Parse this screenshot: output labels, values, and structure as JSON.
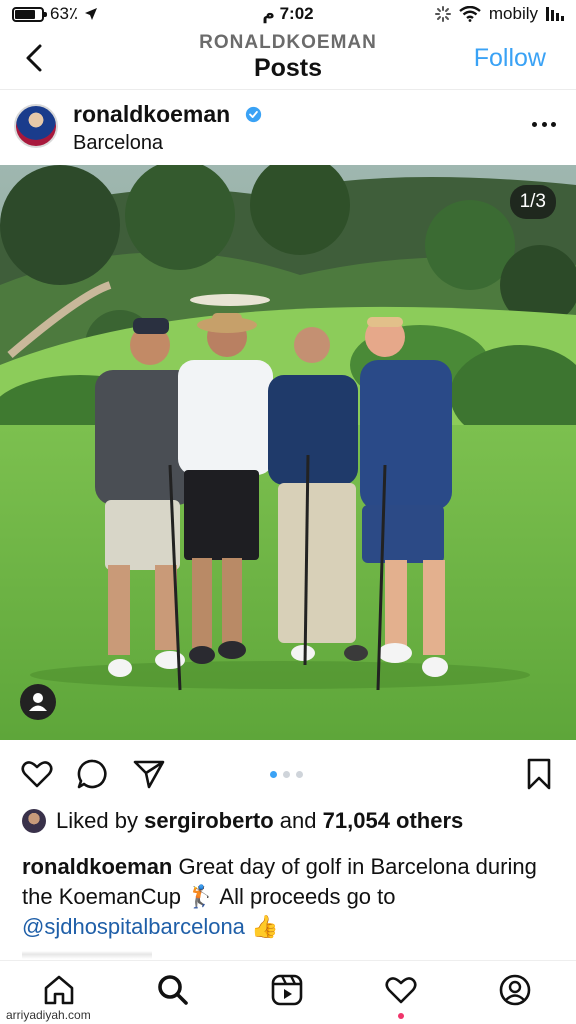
{
  "status_bar": {
    "battery": "63٪",
    "time": "7:02 م",
    "carrier": "mobily"
  },
  "header": {
    "account": "RONALDKOEMAN",
    "title": "Posts",
    "follow_label": "Follow"
  },
  "post": {
    "username": "ronaldkoeman",
    "location": "Barcelona",
    "image_counter": "1/3",
    "carousel_total": 3,
    "carousel_active": 1
  },
  "likes": {
    "prefix": "Liked by",
    "user": "sergiroberto",
    "middle": "and",
    "count": "71,054 others"
  },
  "caption": {
    "username": "ronaldkoeman",
    "text": "Great day of golf in Barcelona during the KoemanCup 🏌️ All proceeds go to",
    "mention": "@sjdhospitalbarcelona",
    "emoji": "👍"
  },
  "icons": {
    "back": "chevron-left-icon",
    "verified": "verified-badge-icon",
    "more": "more-options-icon",
    "like": "heart-icon",
    "comment": "comment-icon",
    "share": "send-icon",
    "save": "bookmark-icon",
    "home": "home-icon",
    "search": "search-icon",
    "reels": "reels-icon",
    "activity": "heart-icon",
    "profile": "profile-icon"
  },
  "colors": {
    "accent": "#3aa2f5",
    "mention": "#1f5fa8",
    "notification": "#f0356b"
  },
  "watermark": "arriyadiyah.com"
}
